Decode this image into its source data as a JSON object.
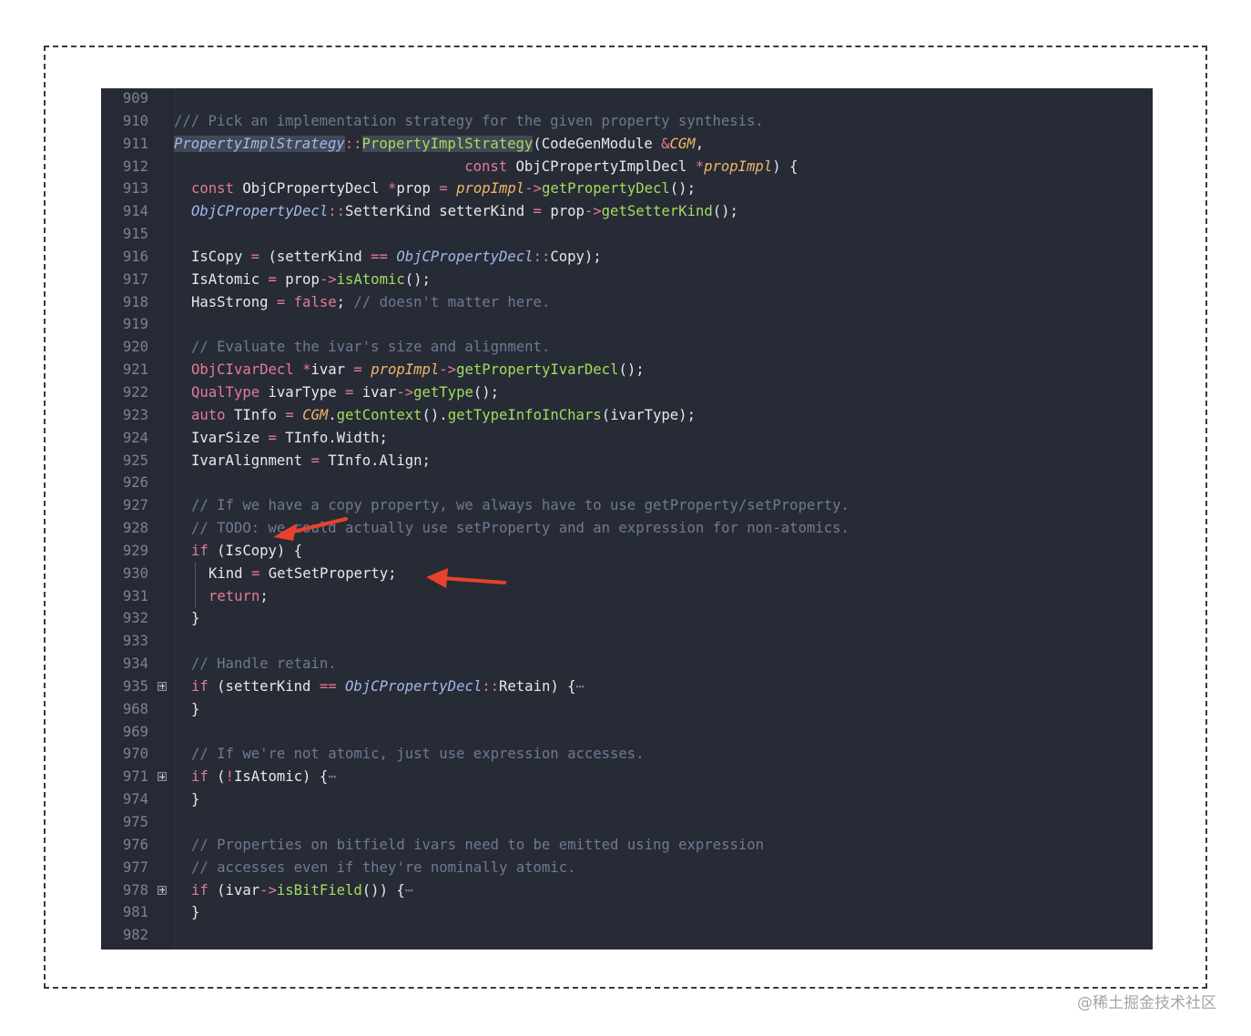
{
  "watermark": "@稀土掘金技术社区",
  "code_lines": [
    {
      "num": "909",
      "fold": false,
      "indent": 0,
      "tokens": []
    },
    {
      "num": "910",
      "fold": false,
      "indent": 0,
      "tokens": [
        {
          "t": "/// Pick an implementation strategy for the given property synthesis.",
          "c": "cm"
        }
      ]
    },
    {
      "num": "911",
      "fold": false,
      "indent": 0,
      "tokens": [
        {
          "t": "PropertyImplStrategy",
          "c": "ty hl"
        },
        {
          "t": "::",
          "c": "op"
        },
        {
          "t": "PropertyImplStrategy",
          "c": "fn hl"
        },
        {
          "t": "(CodeGenModule ",
          "c": ""
        },
        {
          "t": "&",
          "c": "op"
        },
        {
          "t": "CGM",
          "c": "pa"
        },
        {
          "t": ",",
          "c": ""
        }
      ]
    },
    {
      "num": "912",
      "fold": false,
      "indent": 0,
      "tokens": [
        {
          "t": "                                  ",
          "c": ""
        },
        {
          "t": "const",
          "c": "kw"
        },
        {
          "t": " ObjCPropertyImplDecl ",
          "c": ""
        },
        {
          "t": "*",
          "c": "op"
        },
        {
          "t": "propImpl",
          "c": "pa"
        },
        {
          "t": ") {",
          "c": ""
        }
      ]
    },
    {
      "num": "913",
      "fold": false,
      "indent": 1,
      "tokens": [
        {
          "t": "const",
          "c": "kw"
        },
        {
          "t": " ObjCPropertyDecl ",
          "c": ""
        },
        {
          "t": "*",
          "c": "op"
        },
        {
          "t": "prop ",
          "c": ""
        },
        {
          "t": "=",
          "c": "op"
        },
        {
          "t": " ",
          "c": ""
        },
        {
          "t": "propImpl",
          "c": "pa"
        },
        {
          "t": "->",
          "c": "op"
        },
        {
          "t": "getPropertyDecl",
          "c": "fn"
        },
        {
          "t": "();",
          "c": ""
        }
      ]
    },
    {
      "num": "914",
      "fold": false,
      "indent": 1,
      "tokens": [
        {
          "t": "ObjCPropertyDecl",
          "c": "ty"
        },
        {
          "t": "::",
          "c": "op"
        },
        {
          "t": "SetterKind setterKind ",
          "c": ""
        },
        {
          "t": "=",
          "c": "op"
        },
        {
          "t": " prop",
          "c": ""
        },
        {
          "t": "->",
          "c": "op"
        },
        {
          "t": "getSetterKind",
          "c": "fn"
        },
        {
          "t": "();",
          "c": ""
        }
      ]
    },
    {
      "num": "915",
      "fold": false,
      "indent": 0,
      "tokens": []
    },
    {
      "num": "916",
      "fold": false,
      "indent": 1,
      "tokens": [
        {
          "t": "IsCopy ",
          "c": ""
        },
        {
          "t": "=",
          "c": "op"
        },
        {
          "t": " (setterKind ",
          "c": ""
        },
        {
          "t": "==",
          "c": "op"
        },
        {
          "t": " ",
          "c": ""
        },
        {
          "t": "ObjCPropertyDecl",
          "c": "ty"
        },
        {
          "t": "::",
          "c": "op"
        },
        {
          "t": "Copy);",
          "c": ""
        }
      ]
    },
    {
      "num": "917",
      "fold": false,
      "indent": 1,
      "tokens": [
        {
          "t": "IsAtomic ",
          "c": ""
        },
        {
          "t": "=",
          "c": "op"
        },
        {
          "t": " prop",
          "c": ""
        },
        {
          "t": "->",
          "c": "op"
        },
        {
          "t": "isAtomic",
          "c": "fn"
        },
        {
          "t": "();",
          "c": ""
        }
      ]
    },
    {
      "num": "918",
      "fold": false,
      "indent": 1,
      "tokens": [
        {
          "t": "HasStrong ",
          "c": ""
        },
        {
          "t": "=",
          "c": "op"
        },
        {
          "t": " ",
          "c": ""
        },
        {
          "t": "false",
          "c": "kw"
        },
        {
          "t": "; ",
          "c": ""
        },
        {
          "t": "// doesn't matter here.",
          "c": "cm"
        }
      ]
    },
    {
      "num": "919",
      "fold": false,
      "indent": 0,
      "tokens": []
    },
    {
      "num": "920",
      "fold": false,
      "indent": 1,
      "tokens": [
        {
          "t": "// Evaluate the ivar's size and alignment.",
          "c": "cm"
        }
      ]
    },
    {
      "num": "921",
      "fold": false,
      "indent": 1,
      "tokens": [
        {
          "t": "ObjCIvarDecl",
          "c": "kw"
        },
        {
          "t": " ",
          "c": ""
        },
        {
          "t": "*",
          "c": "op"
        },
        {
          "t": "ivar ",
          "c": ""
        },
        {
          "t": "=",
          "c": "op"
        },
        {
          "t": " ",
          "c": ""
        },
        {
          "t": "propImpl",
          "c": "pa"
        },
        {
          "t": "->",
          "c": "op"
        },
        {
          "t": "getPropertyIvarDecl",
          "c": "fn"
        },
        {
          "t": "();",
          "c": ""
        }
      ]
    },
    {
      "num": "922",
      "fold": false,
      "indent": 1,
      "tokens": [
        {
          "t": "QualType",
          "c": "kw"
        },
        {
          "t": " ivarType ",
          "c": ""
        },
        {
          "t": "=",
          "c": "op"
        },
        {
          "t": " ivar",
          "c": ""
        },
        {
          "t": "->",
          "c": "op"
        },
        {
          "t": "getType",
          "c": "fn"
        },
        {
          "t": "();",
          "c": ""
        }
      ]
    },
    {
      "num": "923",
      "fold": false,
      "indent": 1,
      "tokens": [
        {
          "t": "auto",
          "c": "kw"
        },
        {
          "t": " TInfo ",
          "c": ""
        },
        {
          "t": "=",
          "c": "op"
        },
        {
          "t": " ",
          "c": ""
        },
        {
          "t": "CGM",
          "c": "pa"
        },
        {
          "t": ".",
          "c": ""
        },
        {
          "t": "getContext",
          "c": "fn"
        },
        {
          "t": "().",
          "c": ""
        },
        {
          "t": "getTypeInfoInChars",
          "c": "fn"
        },
        {
          "t": "(ivarType);",
          "c": ""
        }
      ]
    },
    {
      "num": "924",
      "fold": false,
      "indent": 1,
      "tokens": [
        {
          "t": "IvarSize ",
          "c": ""
        },
        {
          "t": "=",
          "c": "op"
        },
        {
          "t": " TInfo.Width;",
          "c": ""
        }
      ]
    },
    {
      "num": "925",
      "fold": false,
      "indent": 1,
      "tokens": [
        {
          "t": "IvarAlignment ",
          "c": ""
        },
        {
          "t": "=",
          "c": "op"
        },
        {
          "t": " TInfo.Align;",
          "c": ""
        }
      ]
    },
    {
      "num": "926",
      "fold": false,
      "indent": 0,
      "tokens": []
    },
    {
      "num": "927",
      "fold": false,
      "indent": 1,
      "tokens": [
        {
          "t": "// If we have a copy property, we always have to use getProperty/setProperty.",
          "c": "cm"
        }
      ]
    },
    {
      "num": "928",
      "fold": false,
      "indent": 1,
      "tokens": [
        {
          "t": "// TODO: we could actually use setProperty and an expression for non-atomics.",
          "c": "cm"
        }
      ]
    },
    {
      "num": "929",
      "fold": false,
      "indent": 1,
      "tokens": [
        {
          "t": "if",
          "c": "kw"
        },
        {
          "t": " (IsCopy) {",
          "c": ""
        }
      ]
    },
    {
      "num": "930",
      "fold": false,
      "indent": 2,
      "tokens": [
        {
          "t": "Kind ",
          "c": ""
        },
        {
          "t": "=",
          "c": "op"
        },
        {
          "t": " GetSetProperty;",
          "c": ""
        }
      ]
    },
    {
      "num": "931",
      "fold": false,
      "indent": 2,
      "tokens": [
        {
          "t": "return",
          "c": "kw"
        },
        {
          "t": ";",
          "c": ""
        }
      ]
    },
    {
      "num": "932",
      "fold": false,
      "indent": 1,
      "tokens": [
        {
          "t": "}",
          "c": ""
        }
      ]
    },
    {
      "num": "933",
      "fold": false,
      "indent": 0,
      "tokens": []
    },
    {
      "num": "934",
      "fold": false,
      "indent": 1,
      "tokens": [
        {
          "t": "// Handle retain.",
          "c": "cm"
        }
      ]
    },
    {
      "num": "935",
      "fold": true,
      "indent": 1,
      "tokens": [
        {
          "t": "if",
          "c": "kw"
        },
        {
          "t": " (setterKind ",
          "c": ""
        },
        {
          "t": "==",
          "c": "op"
        },
        {
          "t": " ",
          "c": ""
        },
        {
          "t": "ObjCPropertyDecl",
          "c": "ty"
        },
        {
          "t": "::",
          "c": "op"
        },
        {
          "t": "Retain) {",
          "c": ""
        },
        {
          "t": "⋯",
          "c": "fold"
        }
      ]
    },
    {
      "num": "968",
      "fold": false,
      "indent": 1,
      "tokens": [
        {
          "t": "}",
          "c": ""
        }
      ]
    },
    {
      "num": "969",
      "fold": false,
      "indent": 0,
      "tokens": []
    },
    {
      "num": "970",
      "fold": false,
      "indent": 1,
      "tokens": [
        {
          "t": "// If we're not atomic, just use expression accesses.",
          "c": "cm"
        }
      ]
    },
    {
      "num": "971",
      "fold": true,
      "indent": 1,
      "tokens": [
        {
          "t": "if",
          "c": "kw"
        },
        {
          "t": " (",
          "c": ""
        },
        {
          "t": "!",
          "c": "op"
        },
        {
          "t": "IsAtomic) {",
          "c": ""
        },
        {
          "t": "⋯",
          "c": "fold"
        }
      ]
    },
    {
      "num": "974",
      "fold": false,
      "indent": 1,
      "tokens": [
        {
          "t": "}",
          "c": ""
        }
      ]
    },
    {
      "num": "975",
      "fold": false,
      "indent": 0,
      "tokens": []
    },
    {
      "num": "976",
      "fold": false,
      "indent": 1,
      "tokens": [
        {
          "t": "// Properties on bitfield ivars need to be emitted using expression",
          "c": "cm"
        }
      ]
    },
    {
      "num": "977",
      "fold": false,
      "indent": 1,
      "tokens": [
        {
          "t": "// accesses even if they're nominally atomic.",
          "c": "cm"
        }
      ]
    },
    {
      "num": "978",
      "fold": true,
      "indent": 1,
      "tokens": [
        {
          "t": "if",
          "c": "kw"
        },
        {
          "t": " (ivar",
          "c": ""
        },
        {
          "t": "->",
          "c": "op"
        },
        {
          "t": "isBitField",
          "c": "fn"
        },
        {
          "t": "()) {",
          "c": ""
        },
        {
          "t": "⋯",
          "c": "fold"
        }
      ]
    },
    {
      "num": "981",
      "fold": false,
      "indent": 1,
      "tokens": [
        {
          "t": "}",
          "c": ""
        }
      ]
    },
    {
      "num": "982",
      "fold": false,
      "indent": 0,
      "tokens": []
    }
  ],
  "annotation_color": "#e8412c"
}
